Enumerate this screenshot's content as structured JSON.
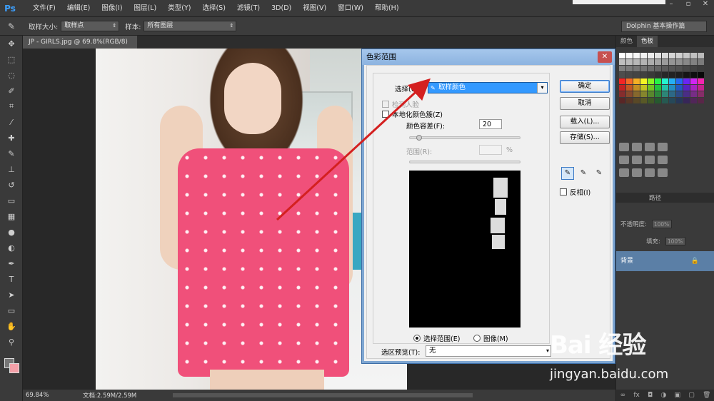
{
  "app": {
    "logo": "Ps"
  },
  "menu": [
    "文件(F)",
    "编辑(E)",
    "图像(I)",
    "图层(L)",
    "类型(Y)",
    "选择(S)",
    "滤镜(T)",
    "3D(D)",
    "视图(V)",
    "窗口(W)",
    "帮助(H)"
  ],
  "options": {
    "sample_size_label": "取样大小:",
    "sample_size_value": "取样点",
    "sample_label": "样本:",
    "sample_value": "所有图层",
    "workspace": "Dolphin 基本操作篇"
  },
  "document": {
    "tab_title": "JP - GIRLS.jpg @ 69.8%(RGB/8)",
    "zoom": "69.84%",
    "doc_size": "文档:2.59M/2.59M"
  },
  "panels": {
    "tab1": "颜色",
    "tab2": "色板",
    "layers_tab": "路径",
    "opacity_label": "不透明度:",
    "opacity_value": "100%",
    "fill_label": "填充:",
    "fill_value": "100%",
    "background_layer": "背景"
  },
  "dialog": {
    "title": "色彩范围",
    "select_label": "选择(C):",
    "select_value": "取样颜色",
    "detect_faces": "检测人脸",
    "localized": "本地化颜色簇(Z)",
    "fuzziness_label": "颜色容差(F):",
    "fuzziness_value": "20",
    "range_label": "范围(R):",
    "range_unit": "%",
    "radio_selection": "选择范围(E)",
    "radio_image": "图像(M)",
    "preview_label": "选区预览(T):",
    "preview_value": "无",
    "ok": "确定",
    "cancel": "取消",
    "load": "载入(L)...",
    "save": "存储(S)...",
    "invert": "反相(I)"
  },
  "watermark": {
    "logo": "Bai 经验",
    "url": "jingyan.baidu.com"
  },
  "colors": {
    "accent": "#3399ff",
    "arrow": "#d42020",
    "dress": "#f0507a"
  }
}
